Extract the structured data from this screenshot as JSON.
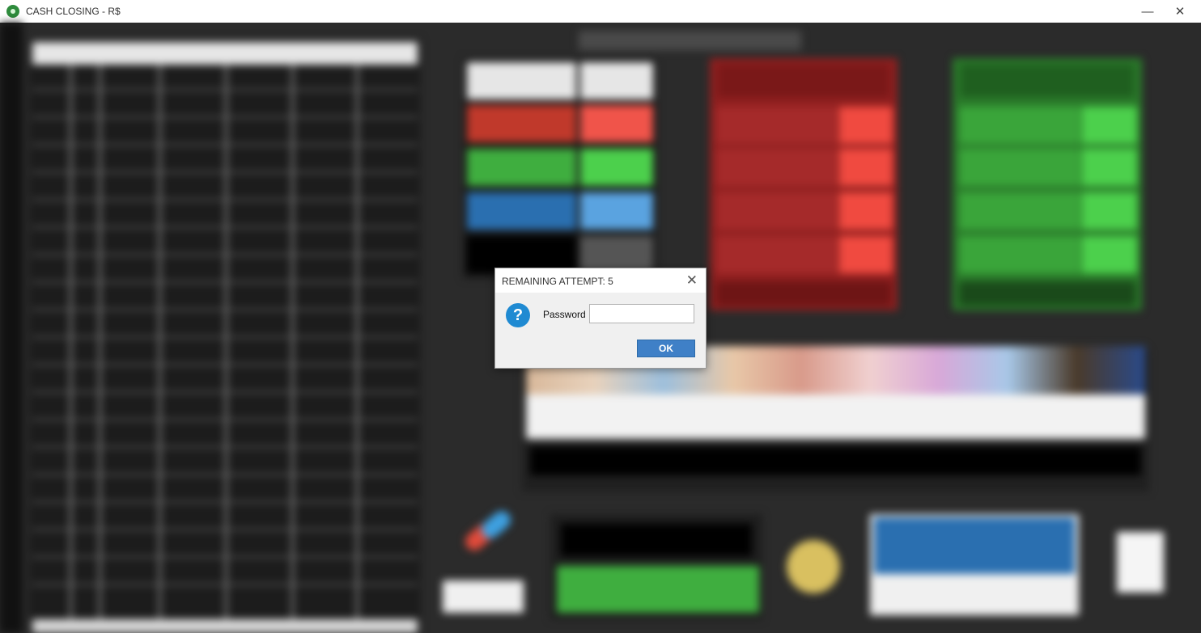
{
  "window": {
    "title": "CASH CLOSING - R$",
    "minimize_icon": "minimize-icon",
    "close_icon": "close-icon"
  },
  "dialog": {
    "title": "REMAINING ATTEMPT: 5",
    "icon": "question-icon",
    "password_label": "Password",
    "password_value": "",
    "ok_label": "OK"
  },
  "colors": {
    "panel_red": "#c0392b",
    "panel_green": "#3fae3f",
    "panel_blue": "#2a6fb0",
    "dialog_button": "#3f80c7"
  }
}
